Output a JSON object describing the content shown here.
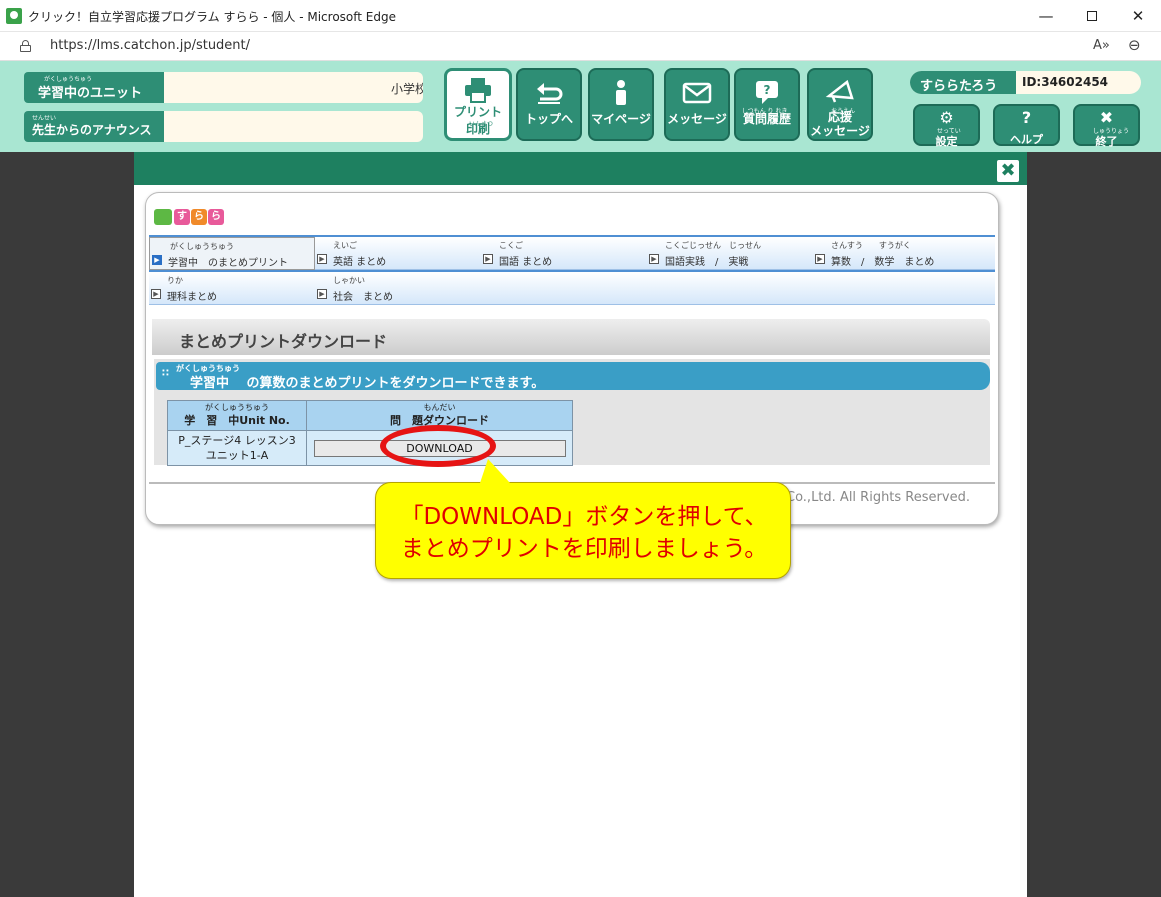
{
  "window": {
    "title": "クリック！自立学習応援プログラム すらら - 個人 - Microsoft Edge",
    "minimize": "—",
    "maximize": "",
    "close": "✕"
  },
  "address_bar": {
    "url": "https://lms.catchon.jp/student/",
    "read_aloud": "A»",
    "zoom": "⊖"
  },
  "header": {
    "unit_label": "学習中のユニット",
    "unit_ruby": "がくしゅうちゅう",
    "unit_value": "小学校",
    "announce_label": "先生からのアナウンス",
    "announce_ruby": "せんせい",
    "announce_value": "",
    "nav": [
      {
        "label_line1": "プリント",
        "ruby": "いんさつ",
        "label_line2": "印刷",
        "icon": "printer-icon"
      },
      {
        "label_line1": "トップへ",
        "icon": "return-arrow-icon"
      },
      {
        "label_line1": "マイページ",
        "icon": "person-icon"
      },
      {
        "label_line1": "メッセージ",
        "icon": "envelope-icon"
      },
      {
        "label_line1": "質問履歴",
        "ruby": "しつもん り れき",
        "icon": "question-bubble-icon"
      },
      {
        "label_line1": "応援",
        "ruby": "おうえん",
        "label_line2": "メッセージ",
        "icon": "megaphone-icon"
      }
    ],
    "username": "すららたろう",
    "user_id": "ID:34602454",
    "utility": [
      {
        "label": "設定",
        "ruby": "せってい",
        "icon": "gear-icon",
        "glyph": "⚙"
      },
      {
        "label": "ヘルプ",
        "icon": "help-icon",
        "glyph": "?"
      },
      {
        "label": "終了",
        "ruby": "しゅうりょう",
        "icon": "exit-icon",
        "glyph": "✖"
      }
    ]
  },
  "modal": {
    "close": "✖",
    "logo_letters": [
      "す",
      "ら",
      "ら"
    ],
    "menu_row1": [
      {
        "ruby": "がくしゅうちゅう",
        "label": "学習中　のまとめプリント",
        "active": true
      },
      {
        "ruby": "えいご",
        "label": "英語 まとめ"
      },
      {
        "ruby": "こくご",
        "label": "国語 まとめ"
      },
      {
        "ruby": "こくごじっせん　じっせん",
        "label": "国語実践　/　実戦"
      },
      {
        "ruby": "さんすう　　すうがく",
        "label": "算数　/　数学　まとめ"
      }
    ],
    "menu_row2": [
      {
        "ruby": "りか",
        "label": "理科まとめ"
      },
      {
        "ruby": "しゃかい",
        "label": "社会　まとめ"
      }
    ],
    "section_title": "まとめプリントダウンロード",
    "info_ruby": "がくしゅうちゅう",
    "info_text": "学習中　 の算数のまとめプリントをダウンロードできます。",
    "table": {
      "col1_ruby": "がくしゅうちゅう",
      "col1_header": "学　習　中Unit No.",
      "col2_ruby": "もんだい",
      "col2_header": "問　題ダウンロード",
      "row_unit": "P_ステージ4 レッスン3 ユニット1-A",
      "download_label": "DOWNLOAD"
    },
    "copyright": "Co.,Ltd. All Rights Reserved."
  },
  "callout": {
    "line1": "「DOWNLOAD」ボタンを押して、",
    "line2": "まとめプリントを印刷しましょう。"
  },
  "colors": {
    "header_bg": "#a9e6d2",
    "brand_green": "#2e8e75",
    "modal_header": "#1e8060",
    "info_bar": "#3a9ec6",
    "callout_bg": "#ffff00",
    "callout_text": "#e00000",
    "highlight_ring": "#e61414"
  }
}
